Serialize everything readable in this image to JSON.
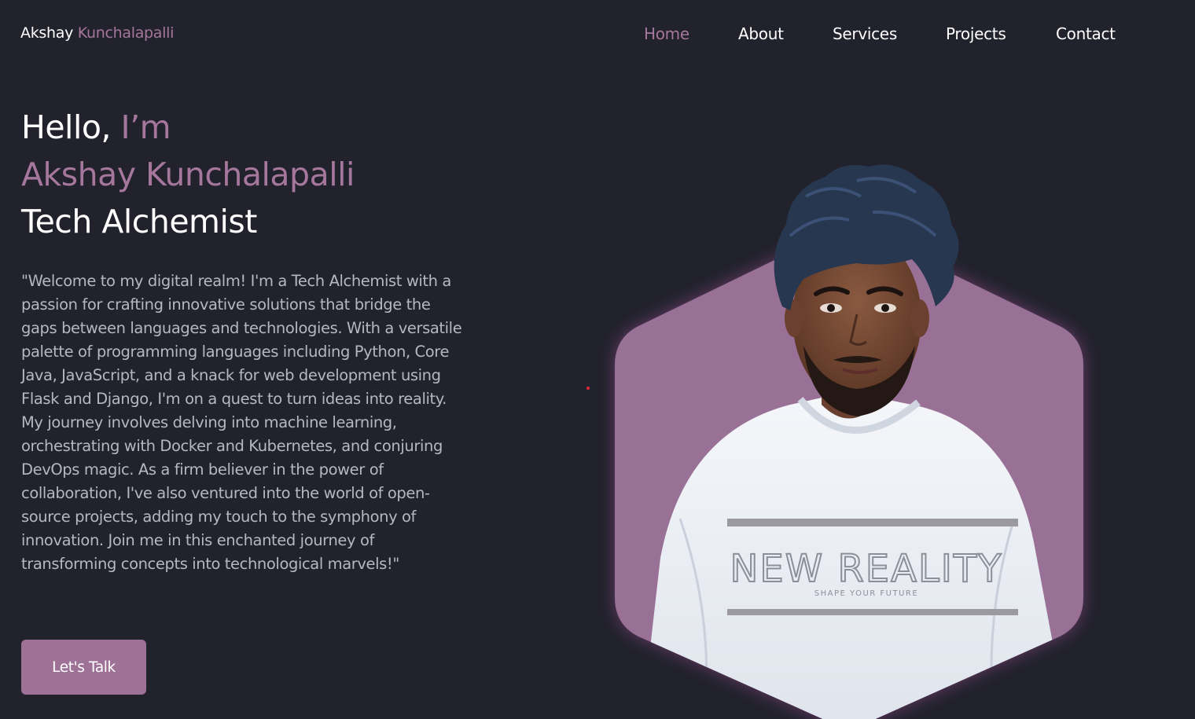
{
  "header": {
    "logo_first": "Akshay",
    "logo_last": "Kunchalapalli",
    "nav": [
      {
        "label": "Home",
        "active": true
      },
      {
        "label": "About",
        "active": false
      },
      {
        "label": "Services",
        "active": false
      },
      {
        "label": "Projects",
        "active": false
      },
      {
        "label": "Contact",
        "active": false
      }
    ]
  },
  "hero": {
    "greeting": "Hello,",
    "greeting_accent": "I’m",
    "name": "Akshay Kunchalapalli",
    "role": "Tech Alchemist",
    "bio": "\"Welcome to my digital realm! I'm a Tech Alchemist with a passion for crafting innovative solutions that bridge the gaps between languages and technologies. With a versatile palette of programming languages including Python, Core Java, JavaScript, and a knack for web development using Flask and Django, I'm on a quest to turn ideas into reality. My journey involves delving into machine learning, orchestrating with Docker and Kubernetes, and conjuring DevOps magic. As a firm believer in the power of collaboration, I've also ventured into the world of open-source projects, adding my touch to the symphony of innovation. Join me in this enchanted journey of transforming concepts into technological marvels!\"",
    "cta_label": "Let's Talk"
  },
  "portrait": {
    "shirt_text": "NEW REALITY",
    "shirt_subtext": "SHAPE YOUR FUTURE"
  },
  "colors": {
    "background": "#21222c",
    "accent": "#a6779c",
    "hexagon": "#9a7196",
    "text_primary": "#ffffff",
    "text_secondary": "#b7b7c1"
  }
}
